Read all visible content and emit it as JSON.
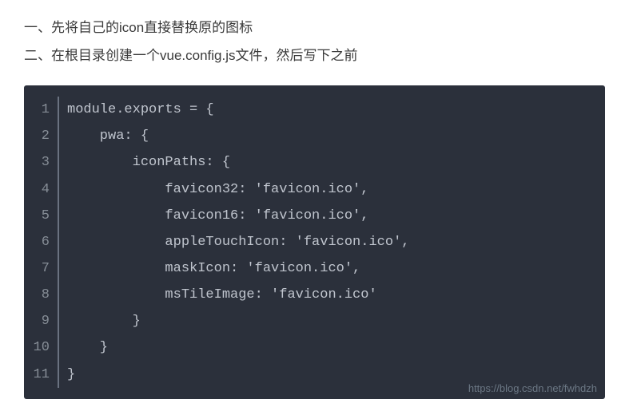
{
  "instructions": [
    "一、先将自己的icon直接替换原的图标",
    "二、在根目录创建一个vue.config.js文件，然后写下之前"
  ],
  "code": {
    "lines": [
      "module.exports = {",
      "    pwa: {",
      "        iconPaths: {",
      "            favicon32: 'favicon.ico',",
      "            favicon16: 'favicon.ico',",
      "            appleTouchIcon: 'favicon.ico',",
      "            maskIcon: 'favicon.ico',",
      "            msTileImage: 'favicon.ico'",
      "        }",
      "    }",
      "}"
    ]
  },
  "watermark": "https://blog.csdn.net/fwhdzh"
}
